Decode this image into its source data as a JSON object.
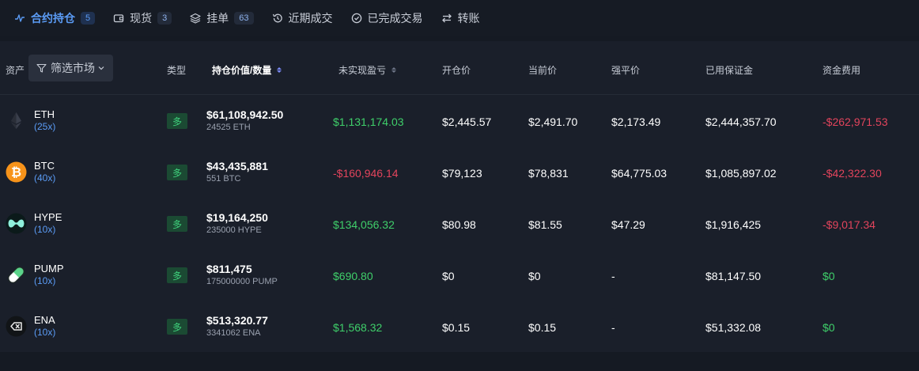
{
  "tabs": [
    {
      "label": "合约持仓",
      "count": "5",
      "icon": "activity-icon"
    },
    {
      "label": "现货",
      "count": "3",
      "icon": "wallet-icon"
    },
    {
      "label": "挂单",
      "count": "63",
      "icon": "layers-icon"
    },
    {
      "label": "近期成交",
      "icon": "history-icon"
    },
    {
      "label": "已完成交易",
      "icon": "check-circle-icon"
    },
    {
      "label": "转账",
      "icon": "transfer-icon"
    }
  ],
  "table": {
    "headers": {
      "asset": "资产",
      "filter": "筛选市场",
      "type": "类型",
      "position_value": "持仓价值/数量",
      "unrealized_pnl": "未实现盈亏",
      "entry_price": "开仓价",
      "mark_price": "当前价",
      "liq_price": "强平价",
      "margin_used": "已用保证金",
      "funding": "资金费用"
    },
    "rows": [
      {
        "coin": "ETH",
        "leverage": "(25x)",
        "side": "多",
        "value": "$61,108,942.50",
        "qty": "24525 ETH",
        "pnl": "$1,131,174.03",
        "pnl_sign": "positive",
        "entry": "$2,445.57",
        "mark": "$2,491.70",
        "liq": "$2,173.49",
        "margin": "$2,444,357.70",
        "funding": "-$262,971.53",
        "funding_sign": "negative",
        "icon": "eth-icon"
      },
      {
        "coin": "BTC",
        "leverage": "(40x)",
        "side": "多",
        "value": "$43,435,881",
        "qty": "551 BTC",
        "pnl": "-$160,946.14",
        "pnl_sign": "negative",
        "entry": "$79,123",
        "mark": "$78,831",
        "liq": "$64,775.03",
        "margin": "$1,085,897.02",
        "funding": "-$42,322.30",
        "funding_sign": "negative",
        "icon": "btc-icon"
      },
      {
        "coin": "HYPE",
        "leverage": "(10x)",
        "side": "多",
        "value": "$19,164,250",
        "qty": "235000 HYPE",
        "pnl": "$134,056.32",
        "pnl_sign": "positive",
        "entry": "$80.98",
        "mark": "$81.55",
        "liq": "$47.29",
        "margin": "$1,916,425",
        "funding": "-$9,017.34",
        "funding_sign": "negative",
        "icon": "hype-icon"
      },
      {
        "coin": "PUMP",
        "leverage": "(10x)",
        "side": "多",
        "value": "$811,475",
        "qty": "175000000 PUMP",
        "pnl": "$690.80",
        "pnl_sign": "positive",
        "entry": "$0",
        "mark": "$0",
        "liq": "-",
        "margin": "$81,147.50",
        "funding": "$0",
        "funding_sign": "positive",
        "icon": "pump-icon"
      },
      {
        "coin": "ENA",
        "leverage": "(10x)",
        "side": "多",
        "value": "$513,320.77",
        "qty": "3341062 ENA",
        "pnl": "$1,568.32",
        "pnl_sign": "positive",
        "entry": "$0.15",
        "mark": "$0.15",
        "liq": "-",
        "margin": "$51,332.08",
        "funding": "$0",
        "funding_sign": "positive",
        "icon": "ena-icon"
      }
    ]
  },
  "colors": {
    "accent": "#5b9cf6",
    "positive": "#3fcf6a",
    "negative": "#e2445c",
    "long_badge_bg": "#1b4a33",
    "long_badge_text": "#3fd17c"
  }
}
